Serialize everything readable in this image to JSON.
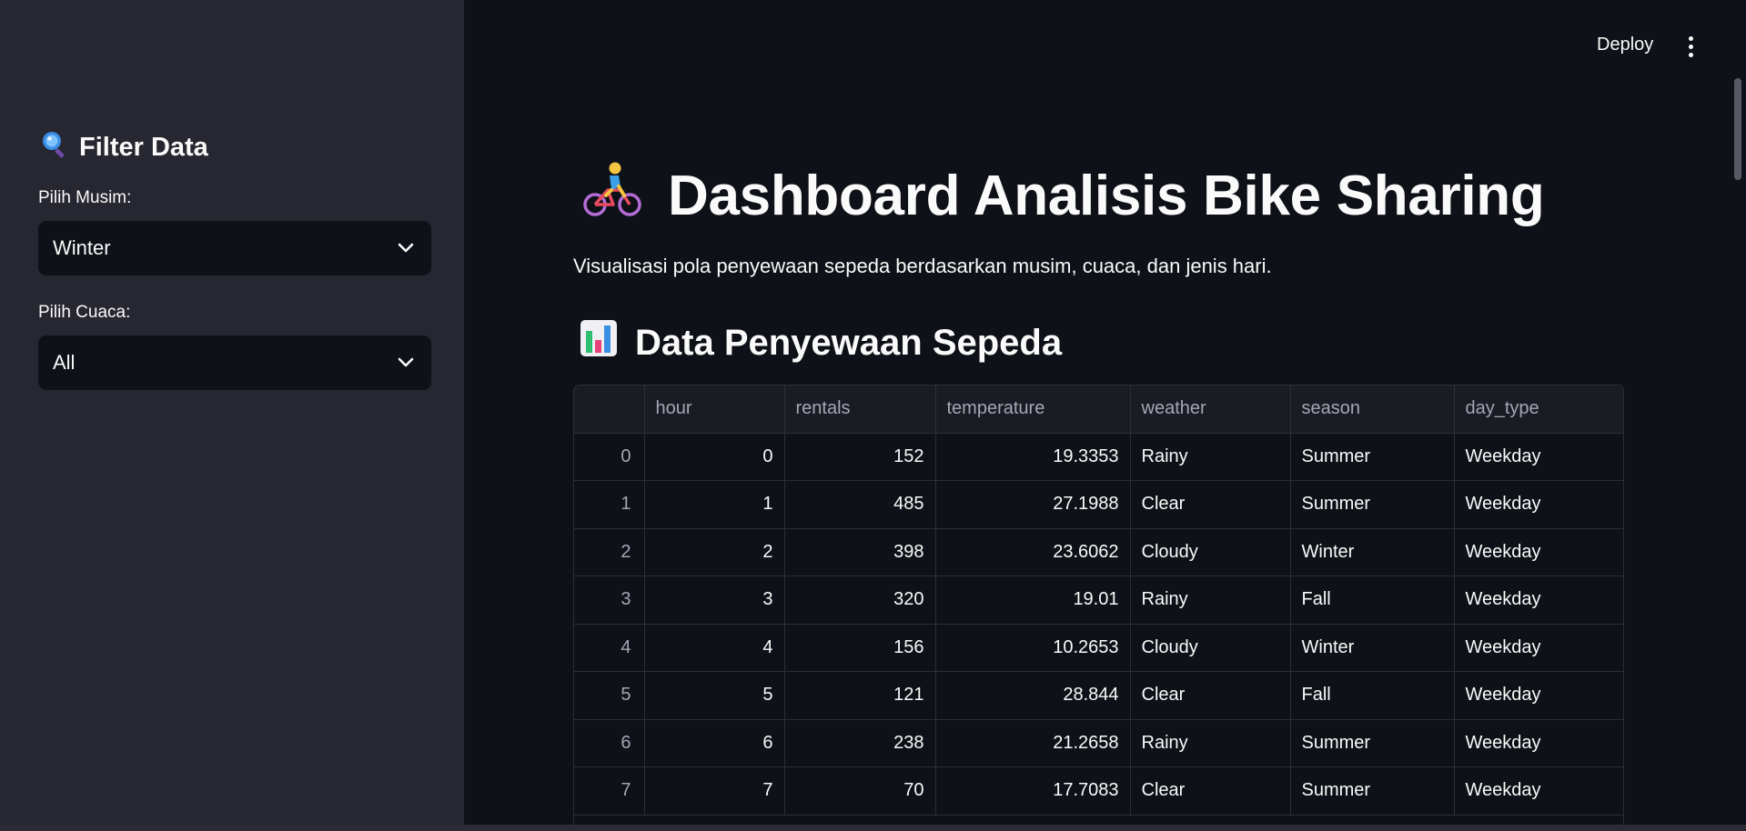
{
  "sidebar": {
    "title": "Filter Data",
    "title_icon": "magnifier-icon",
    "season_label": "Pilih Musim:",
    "season_value": "Winter",
    "weather_label": "Pilih Cuaca:",
    "weather_value": "All"
  },
  "header": {
    "deploy_label": "Deploy",
    "menu_icon": "kebab-menu-icon"
  },
  "main": {
    "title": "Dashboard Analisis Bike Sharing",
    "title_icon": "cyclist-icon",
    "subtitle": "Visualisasi pola penyewaan sepeda berdasarkan musim, cuaca, dan jenis hari.",
    "section_title": "Data Penyewaan Sepeda",
    "section_icon": "bar-chart-icon"
  },
  "table": {
    "columns": [
      "",
      "hour",
      "rentals",
      "temperature",
      "weather",
      "season",
      "day_type"
    ],
    "rows": [
      [
        "0",
        "0",
        "152",
        "19.3353",
        "Rainy",
        "Summer",
        "Weekday"
      ],
      [
        "1",
        "1",
        "485",
        "27.1988",
        "Clear",
        "Summer",
        "Weekday"
      ],
      [
        "2",
        "2",
        "398",
        "23.6062",
        "Cloudy",
        "Winter",
        "Weekday"
      ],
      [
        "3",
        "3",
        "320",
        "19.01",
        "Rainy",
        "Fall",
        "Weekday"
      ],
      [
        "4",
        "4",
        "156",
        "10.2653",
        "Cloudy",
        "Winter",
        "Weekday"
      ],
      [
        "5",
        "5",
        "121",
        "28.844",
        "Clear",
        "Fall",
        "Weekday"
      ],
      [
        "6",
        "6",
        "238",
        "21.2658",
        "Rainy",
        "Summer",
        "Weekday"
      ],
      [
        "7",
        "7",
        "70",
        "17.7083",
        "Clear",
        "Summer",
        "Weekday"
      ]
    ]
  },
  "colors": {
    "main_bg": "#0e1117",
    "sidebar_bg": "#262730",
    "text": "#fafafa",
    "muted": "#a3a8b4"
  }
}
